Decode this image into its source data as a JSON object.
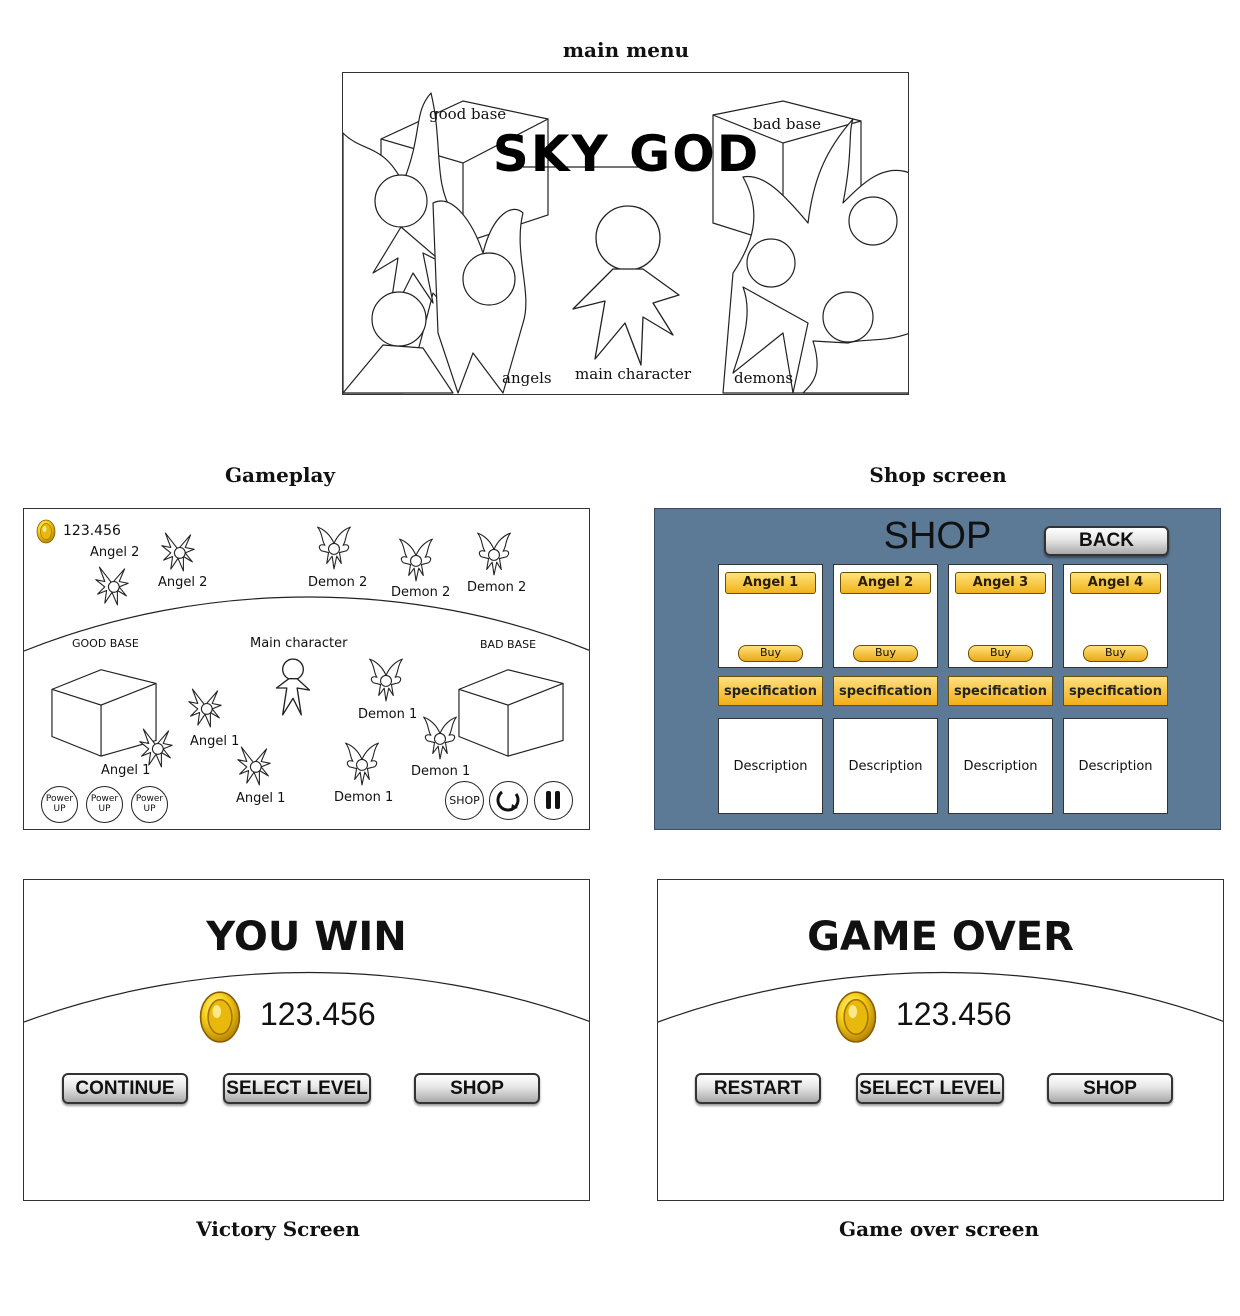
{
  "captions": {
    "main_menu": "main menu",
    "gameplay": "Gameplay",
    "shop": "Shop screen",
    "victory": "Victory Screen",
    "game_over": "Game over screen"
  },
  "main_menu": {
    "title": "SKY GOD",
    "good_base": "good base",
    "bad_base": "bad base",
    "angels": "angels",
    "main_character": "main character",
    "demons": "demons"
  },
  "gameplay": {
    "coins": "123.456",
    "units_top": {
      "angel2_a": "Angel 2",
      "angel2_b": "Angel 2",
      "demon2_a": "Demon 2",
      "demon2_b": "Demon 2",
      "demon2_c": "Demon 2"
    },
    "good_base": "GOOD BASE",
    "bad_base": "BAD BASE",
    "main_character": "Main character",
    "units_bottom": {
      "angel1_a": "Angel 1",
      "angel1_b": "Angel 1",
      "angel1_c": "Angel 1",
      "demon1_a": "Demon 1",
      "demon1_b": "Demon 1",
      "demon1_c": "Demon 1"
    },
    "power_up": [
      "Power",
      "UP"
    ],
    "shop_button": "SHOP"
  },
  "shop": {
    "title": "SHOP",
    "back": "BACK",
    "items": [
      {
        "name": "Angel 1",
        "buy": "Buy",
        "spec": "specification",
        "desc": "Description"
      },
      {
        "name": "Angel 2",
        "buy": "Buy",
        "spec": "specification",
        "desc": "Description"
      },
      {
        "name": "Angel 3",
        "buy": "Buy",
        "spec": "specification",
        "desc": "Description"
      },
      {
        "name": "Angel 4",
        "buy": "Buy",
        "spec": "specification",
        "desc": "Description"
      }
    ]
  },
  "victory": {
    "title": "YOU WIN",
    "coins": "123.456",
    "continue": "CONTINUE",
    "select_level": "SELECT LEVEL",
    "shop": "SHOP"
  },
  "game_over": {
    "title": "GAME OVER",
    "coins": "123.456",
    "restart": "RESTART",
    "select_level": "SELECT LEVEL",
    "shop": "SHOP"
  },
  "colors": {
    "shop_bg": "#5c7a96",
    "gold": "#f0b31c"
  },
  "icons": [
    "coin-icon",
    "angel-icon",
    "demon-icon",
    "cube-icon",
    "character-icon",
    "restart-icon",
    "pause-icon"
  ]
}
